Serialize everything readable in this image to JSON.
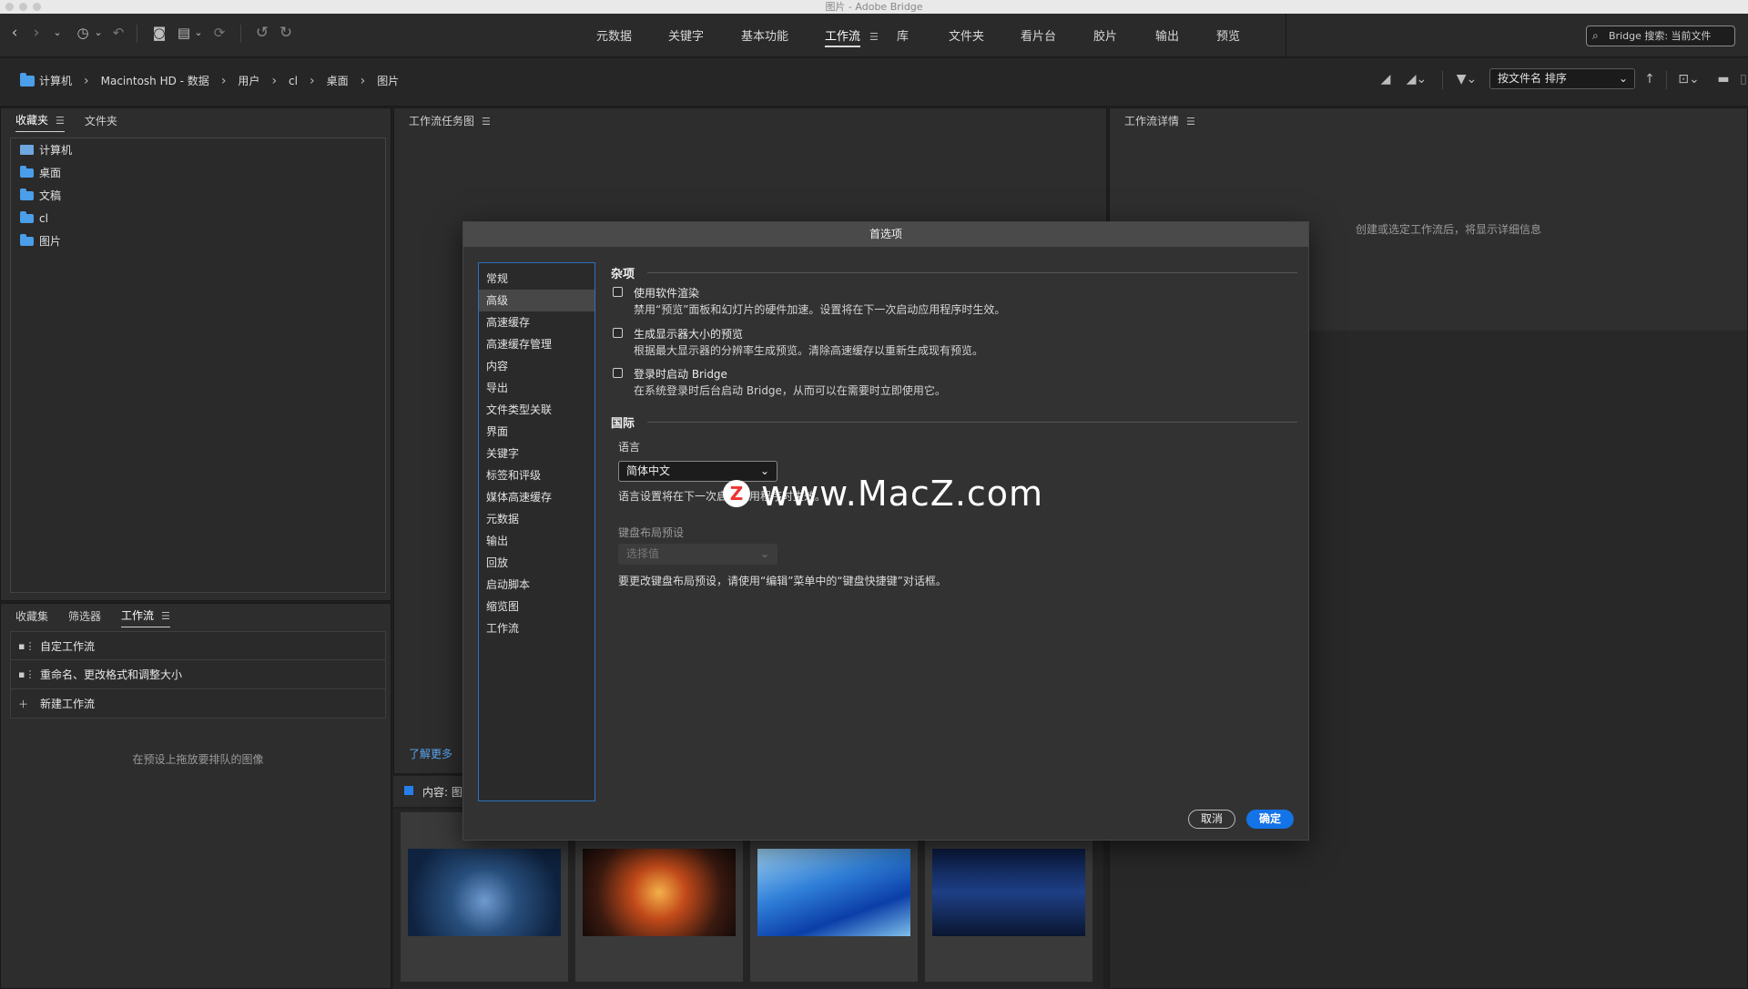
{
  "window": {
    "title": "图片 - Adobe Bridge"
  },
  "toolbar": {
    "workspaces": [
      {
        "label": "元数据",
        "active": false
      },
      {
        "label": "关键字",
        "active": false
      },
      {
        "label": "基本功能",
        "active": false
      },
      {
        "label": "工作流",
        "active": true
      },
      {
        "label": "库",
        "active": false
      },
      {
        "label": "文件夹",
        "active": false
      },
      {
        "label": "看片台",
        "active": false
      },
      {
        "label": "胶片",
        "active": false
      },
      {
        "label": "输出",
        "active": false
      },
      {
        "label": "预览",
        "active": false
      }
    ],
    "search_text": "Bridge 搜索: 当前文件"
  },
  "pathbar": {
    "breadcrumb": [
      "计算机",
      "Macintosh HD - 数据",
      "用户",
      "cl",
      "桌面",
      "图片"
    ],
    "sort_label": "按文件名 排序"
  },
  "left_top_panel": {
    "tabs": [
      {
        "label": "收藏夹",
        "active": true
      },
      {
        "label": "文件夹",
        "active": false
      }
    ],
    "favorites": [
      {
        "label": "计算机",
        "icon": "computer-icon"
      },
      {
        "label": "桌面",
        "icon": "folder-icon"
      },
      {
        "label": "文稿",
        "icon": "folder-icon"
      },
      {
        "label": "cl",
        "icon": "folder-icon"
      },
      {
        "label": "图片",
        "icon": "folder-icon"
      }
    ]
  },
  "left_bottom_panel": {
    "tabs": [
      {
        "label": "收藏集",
        "active": false
      },
      {
        "label": "筛选器",
        "active": false
      },
      {
        "label": "工作流",
        "active": true
      }
    ],
    "workflows": [
      {
        "label": "自定工作流",
        "icon": "workflow-icon"
      },
      {
        "label": "重命名、更改格式和调整大小",
        "icon": "workflow-icon"
      },
      {
        "label": "新建工作流",
        "icon": "plus-icon"
      }
    ],
    "drop_hint": "在预设上拖放要排队的图像"
  },
  "center_panel": {
    "title": "工作流任务图",
    "learn_more": "了解更多",
    "content_label": "内容: 图"
  },
  "right_panel": {
    "title": "工作流详情",
    "hint": "创建或选定工作流后，将显示详细信息"
  },
  "dialog": {
    "title": "首选项",
    "categories": [
      "常规",
      "高级",
      "高速缓存",
      "高速缓存管理",
      "内容",
      "导出",
      "文件类型关联",
      "界面",
      "关键字",
      "标签和评级",
      "媒体高速缓存",
      "元数据",
      "输出",
      "回放",
      "启动脚本",
      "缩览图",
      "工作流"
    ],
    "selected_category": "高级",
    "misc_heading": "杂项",
    "options": [
      {
        "label": "使用软件渲染",
        "desc": "禁用“预览”面板和幻灯片的硬件加速。设置将在下一次启动应用程序时生效。",
        "checked": false
      },
      {
        "label": "生成显示器大小的预览",
        "desc": "根据最大显示器的分辨率生成预览。清除高速缓存以重新生成现有预览。",
        "checked": false
      },
      {
        "label": "登录时启动 Bridge",
        "desc": "在系统登录时后台启动 Bridge，从而可以在需要时立即使用它。",
        "checked": false
      }
    ],
    "intl_heading": "国际",
    "language_label": "语言",
    "language_value": "简体中文",
    "language_note": "语言设置将在下一次启动应用程序时生效。",
    "kb_label": "键盘布局预设",
    "kb_value": "选择值",
    "kb_note": "要更改键盘布局预设，请使用“编辑”菜单中的“键盘快捷键”对话框。",
    "cancel_label": "取消",
    "ok_label": "确定"
  },
  "watermark": {
    "logo": "Z",
    "text": "www.MacZ.com"
  }
}
